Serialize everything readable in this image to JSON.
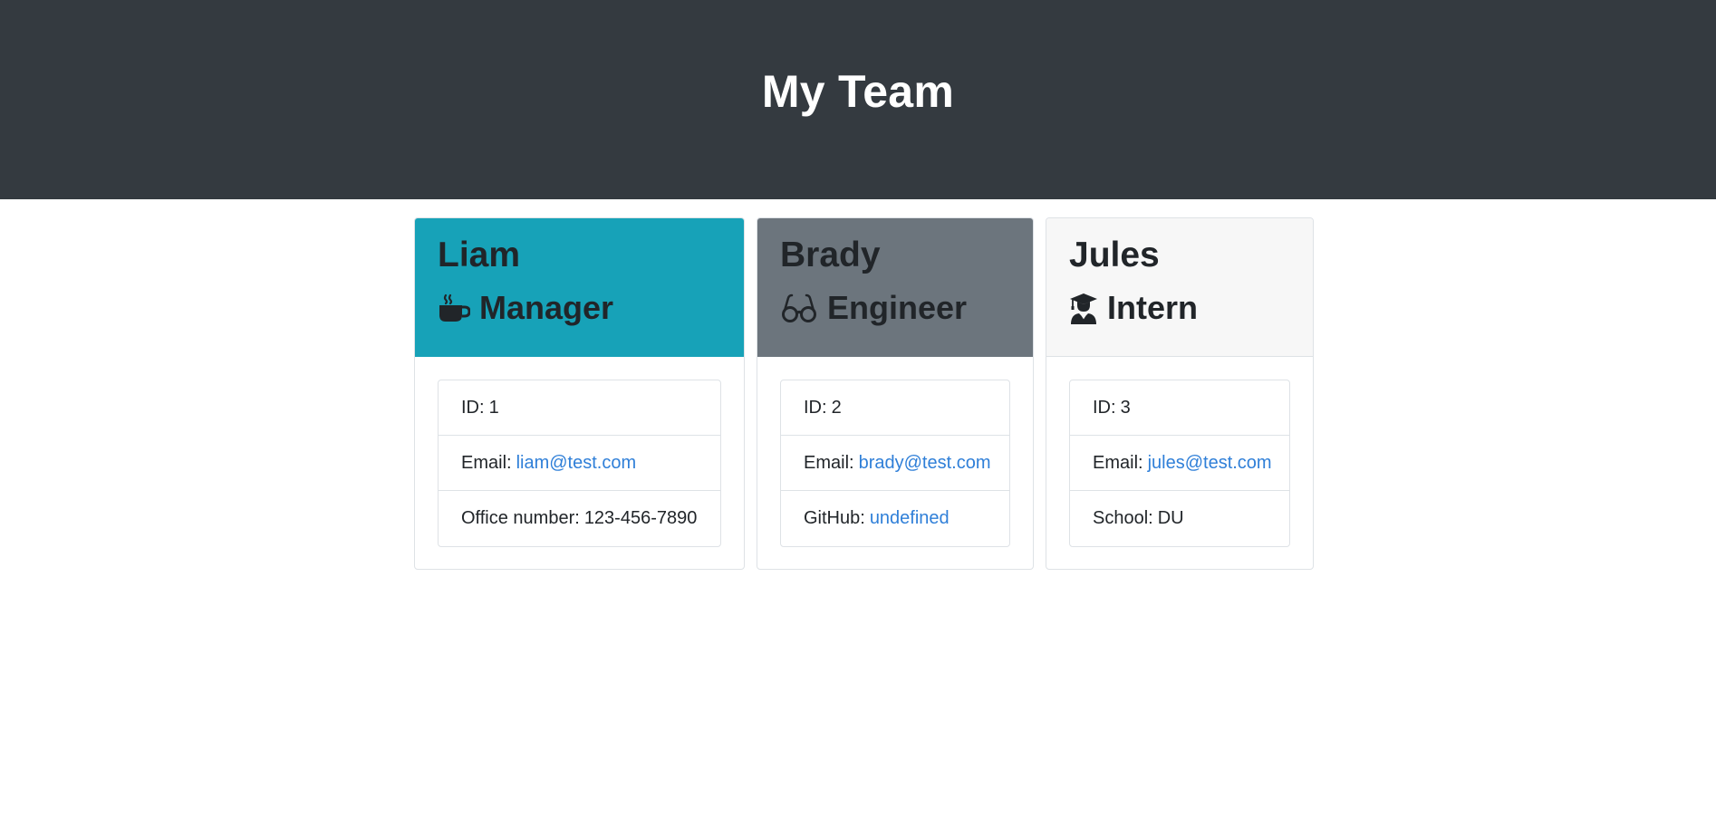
{
  "header": {
    "title": "My Team"
  },
  "colors": {
    "header_bg": "#343a40",
    "manager_bg": "#17a2b8",
    "engineer_bg": "#6c757d",
    "intern_bg": "#f7f7f7",
    "link": "#2f7fd8"
  },
  "team": [
    {
      "name": "Liam",
      "role": "Manager",
      "icon": "coffee-mug-icon",
      "id_label": "ID:",
      "id": "1",
      "email_label": "Email:",
      "email": "liam@test.com",
      "extra_label": "Office number:",
      "extra_value": "123-456-7890"
    },
    {
      "name": "Brady",
      "role": "Engineer",
      "icon": "glasses-icon",
      "id_label": "ID:",
      "id": "2",
      "email_label": "Email:",
      "email": "brady@test.com",
      "extra_label": "GitHub:",
      "extra_value": "undefined"
    },
    {
      "name": "Jules",
      "role": "Intern",
      "icon": "graduate-icon",
      "id_label": "ID:",
      "id": "3",
      "email_label": "Email:",
      "email": "jules@test.com",
      "extra_label": "School:",
      "extra_value": "DU"
    }
  ]
}
